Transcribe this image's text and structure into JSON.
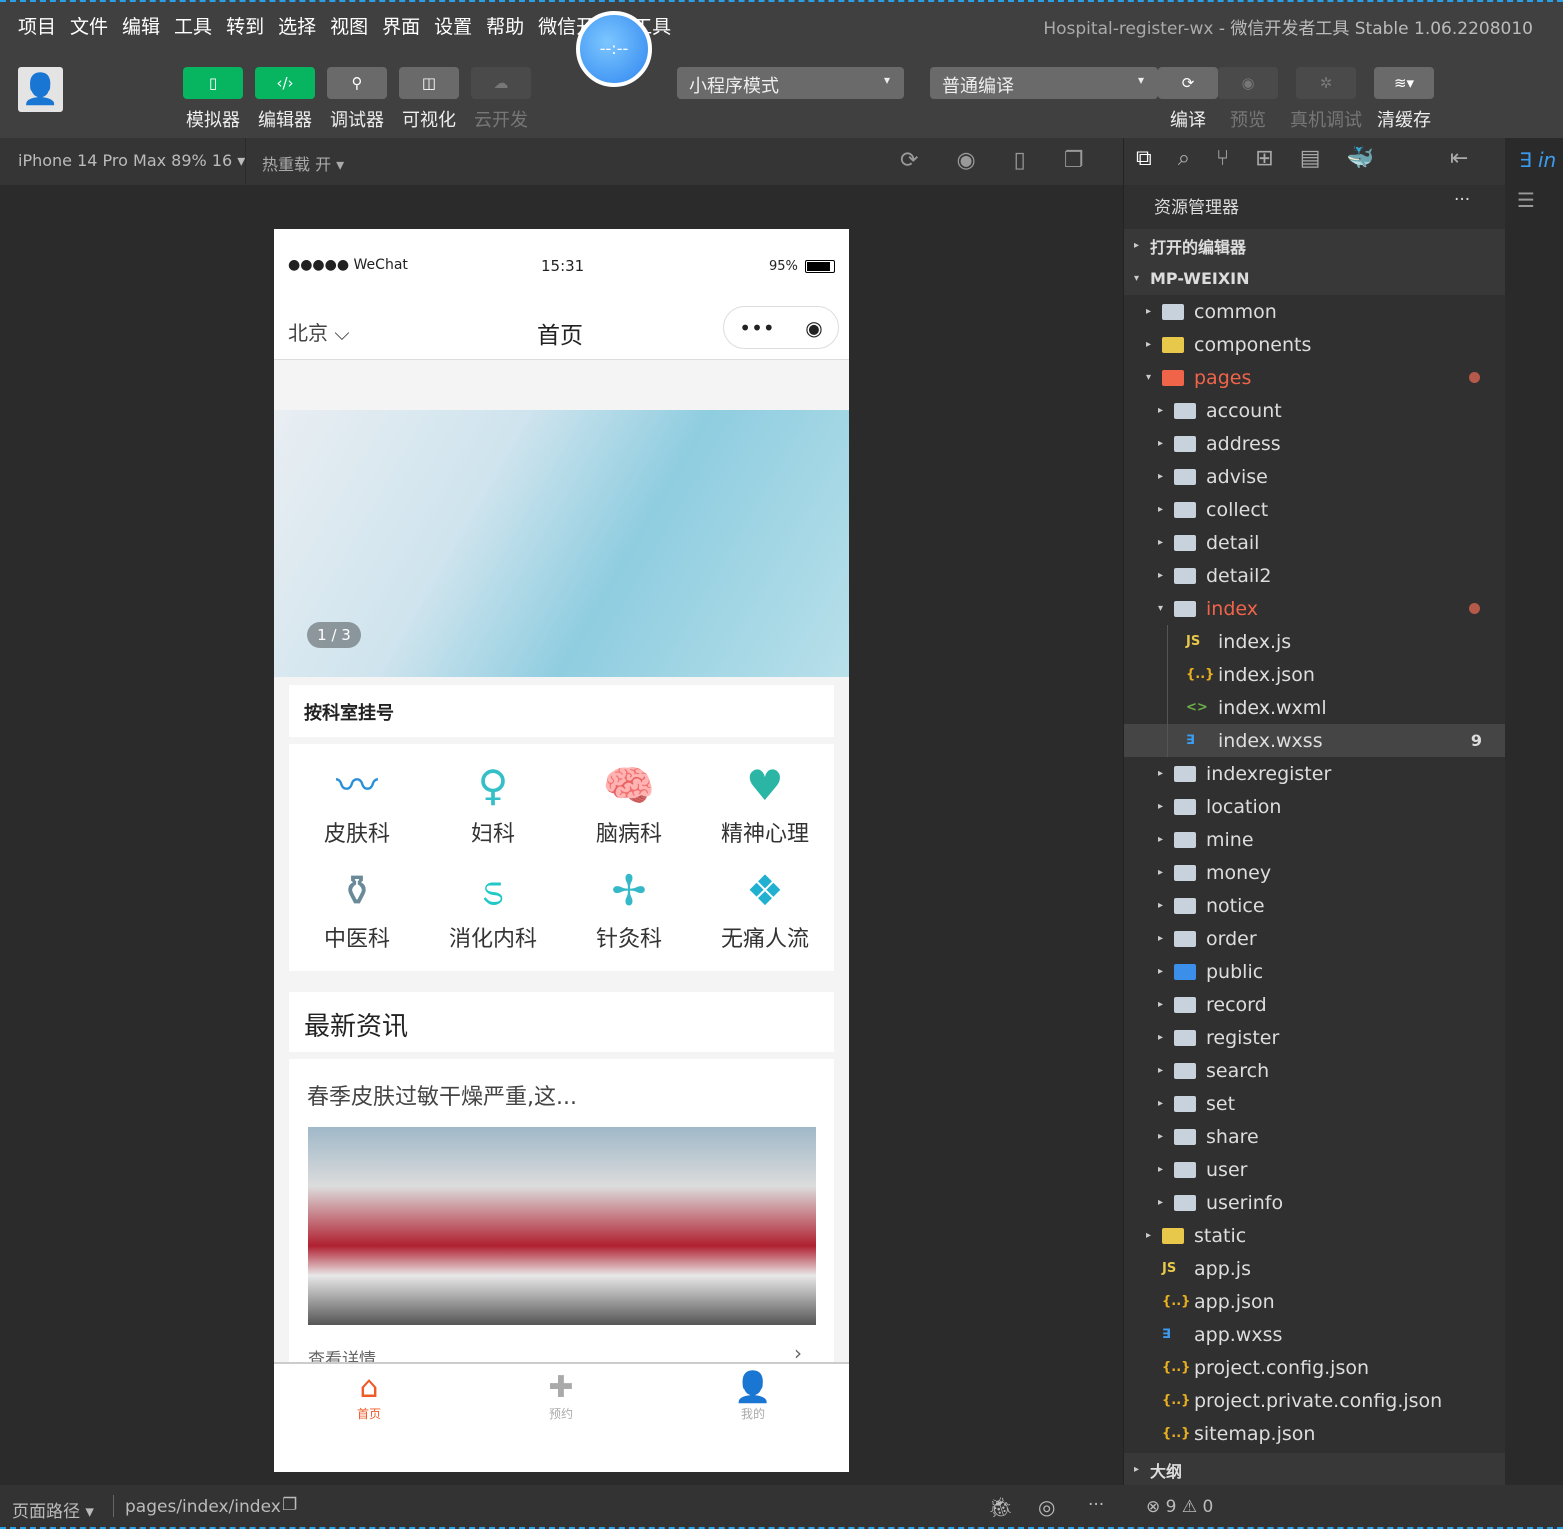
{
  "menu": [
    "项目",
    "文件",
    "编辑",
    "工具",
    "转到",
    "选择",
    "视图",
    "界面",
    "设置",
    "帮助",
    "微信开发者工具"
  ],
  "window_title": {
    "project": "Hospital-register-wx",
    "app": " - 微信开发者工具 Stable 1.06.2208010"
  },
  "timer": "--:--",
  "toolbar": {
    "left": [
      {
        "label": "模拟器",
        "icon": "phone-icon",
        "active": true
      },
      {
        "label": "编辑器",
        "icon": "code-icon",
        "active": true
      },
      {
        "label": "调试器",
        "icon": "sliders-icon",
        "active": false
      },
      {
        "label": "可视化",
        "icon": "layout-icon",
        "active": false
      },
      {
        "label": "云开发",
        "icon": "cloud-icon",
        "disabled": true
      }
    ],
    "mode": "小程序模式",
    "compile": "普通编译",
    "right": [
      {
        "label": "编译",
        "icon": "refresh-icon"
      },
      {
        "label": "预览",
        "icon": "eye-icon",
        "disabled": true
      },
      {
        "label": "真机调试",
        "icon": "bug-icon",
        "disabled": true
      },
      {
        "label": "清缓存",
        "icon": "layers-icon"
      }
    ]
  },
  "simbar": {
    "device": "iPhone 14 Pro Max 89% 16 ▾",
    "hotreload": "热重载 开 ▾"
  },
  "phone": {
    "signal": "●●●●● WeChat",
    "time": "15:31",
    "battery": "95%",
    "city": "北京",
    "title": "首页",
    "banner_counter": "1 / 3",
    "section_title": "按科室挂号",
    "departments": [
      {
        "name": "皮肤科",
        "icon": "〰"
      },
      {
        "name": "妇科",
        "icon": "♀"
      },
      {
        "name": "脑病科",
        "icon": "🧠"
      },
      {
        "name": "精神心理",
        "icon": "♥"
      },
      {
        "name": "中医科",
        "icon": "⚱"
      },
      {
        "name": "消化内科",
        "icon": "ಽ"
      },
      {
        "name": "针灸科",
        "icon": "✢"
      },
      {
        "name": "无痛人流",
        "icon": "❖"
      }
    ],
    "news_title": "最新资讯",
    "news_item": "春季皮肤过敏干燥严重,这...",
    "view_detail": "查看详情",
    "tabs": [
      {
        "label": "首页",
        "active": true
      },
      {
        "label": "预约"
      },
      {
        "label": "我的"
      }
    ]
  },
  "explorer": {
    "title": "资源管理器",
    "more": "···",
    "open_editors": "打开的编辑器",
    "root": "MP-WEIXIN",
    "tree": [
      {
        "name": "common",
        "depth": 1,
        "type": "folder",
        "arrow": "▸"
      },
      {
        "name": "components",
        "depth": 1,
        "type": "folder-y",
        "arrow": "▸"
      },
      {
        "name": "pages",
        "depth": 1,
        "type": "folder-r",
        "arrow": "▾",
        "color": "#f0644a",
        "dot": true
      },
      {
        "name": "account",
        "depth": 2,
        "type": "folder",
        "arrow": "▸"
      },
      {
        "name": "address",
        "depth": 2,
        "type": "folder",
        "arrow": "▸"
      },
      {
        "name": "advise",
        "depth": 2,
        "type": "folder",
        "arrow": "▸"
      },
      {
        "name": "collect",
        "depth": 2,
        "type": "folder",
        "arrow": "▸"
      },
      {
        "name": "detail",
        "depth": 2,
        "type": "folder",
        "arrow": "▸"
      },
      {
        "name": "detail2",
        "depth": 2,
        "type": "folder",
        "arrow": "▸"
      },
      {
        "name": "index",
        "depth": 2,
        "type": "folder-open",
        "arrow": "▾",
        "color": "#f0644a",
        "dot": true
      },
      {
        "name": "index.js",
        "depth": 3,
        "type": "js"
      },
      {
        "name": "index.json",
        "depth": 3,
        "type": "json"
      },
      {
        "name": "index.wxml",
        "depth": 3,
        "type": "wxml"
      },
      {
        "name": "index.wxss",
        "depth": 3,
        "type": "css",
        "selected": true,
        "badge": "9"
      },
      {
        "name": "indexregister",
        "depth": 2,
        "type": "folder",
        "arrow": "▸"
      },
      {
        "name": "location",
        "depth": 2,
        "type": "folder",
        "arrow": "▸"
      },
      {
        "name": "mine",
        "depth": 2,
        "type": "folder",
        "arrow": "▸"
      },
      {
        "name": "money",
        "depth": 2,
        "type": "folder",
        "arrow": "▸"
      },
      {
        "name": "notice",
        "depth": 2,
        "type": "folder",
        "arrow": "▸"
      },
      {
        "name": "order",
        "depth": 2,
        "type": "folder",
        "arrow": "▸"
      },
      {
        "name": "public",
        "depth": 2,
        "type": "folder-b",
        "arrow": "▸"
      },
      {
        "name": "record",
        "depth": 2,
        "type": "folder",
        "arrow": "▸"
      },
      {
        "name": "register",
        "depth": 2,
        "type": "folder",
        "arrow": "▸"
      },
      {
        "name": "search",
        "depth": 2,
        "type": "folder",
        "arrow": "▸"
      },
      {
        "name": "set",
        "depth": 2,
        "type": "folder",
        "arrow": "▸"
      },
      {
        "name": "share",
        "depth": 2,
        "type": "folder",
        "arrow": "▸"
      },
      {
        "name": "user",
        "depth": 2,
        "type": "folder",
        "arrow": "▸"
      },
      {
        "name": "userinfo",
        "depth": 2,
        "type": "folder",
        "arrow": "▸"
      },
      {
        "name": "static",
        "depth": 1,
        "type": "folder-y",
        "arrow": "▸"
      },
      {
        "name": "app.js",
        "depth": 1,
        "type": "js"
      },
      {
        "name": "app.json",
        "depth": 1,
        "type": "json"
      },
      {
        "name": "app.wxss",
        "depth": 1,
        "type": "css"
      },
      {
        "name": "project.config.json",
        "depth": 1,
        "type": "json"
      },
      {
        "name": "project.private.config.json",
        "depth": 1,
        "type": "json"
      },
      {
        "name": "sitemap.json",
        "depth": 1,
        "type": "json"
      }
    ],
    "outline": "大纲"
  },
  "editor_tab": "in",
  "status": {
    "path_label": "页面路径 ▾",
    "path": "pages/index/index",
    "errors": "9",
    "warnings": "0"
  }
}
